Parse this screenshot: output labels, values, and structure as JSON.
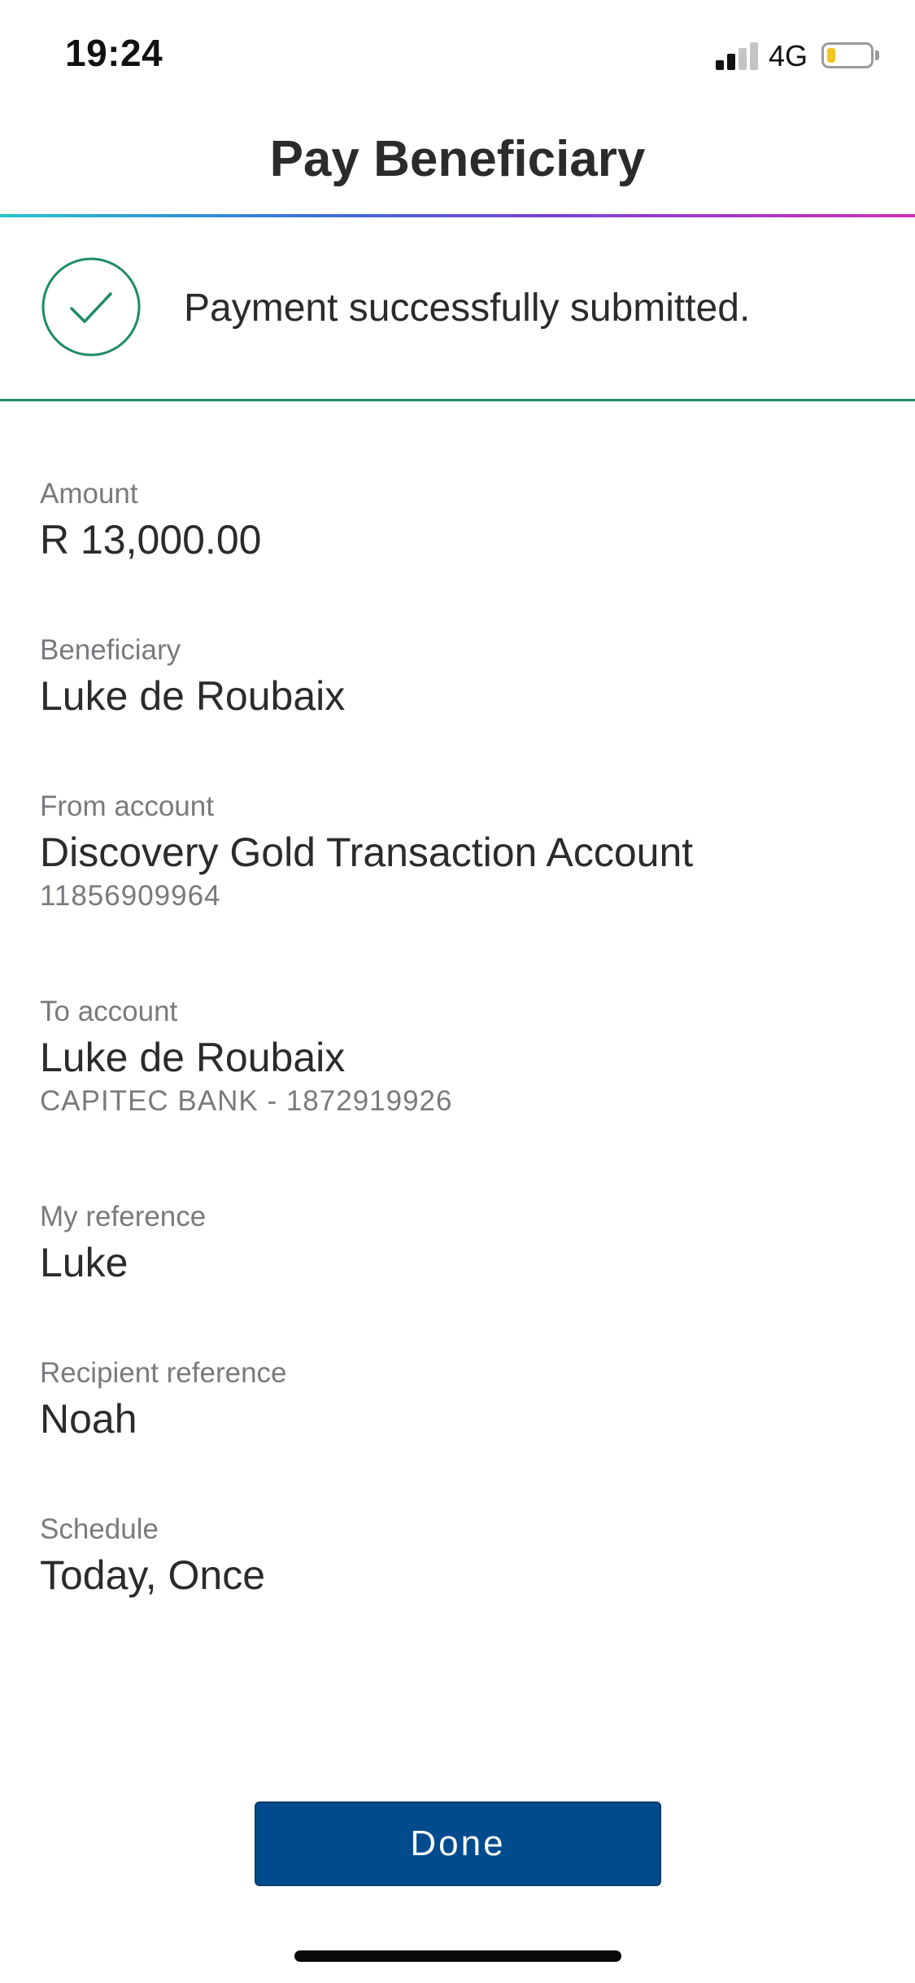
{
  "status_bar": {
    "time": "19:24",
    "network": "4G",
    "signal_icon": "cellular-signal-icon",
    "signal_bars_active": 2,
    "signal_bars_total": 4,
    "battery_icon": "battery-icon",
    "battery_level": 0.2,
    "battery_color": "#f3c623"
  },
  "header": {
    "title": "Pay Beneficiary"
  },
  "banner": {
    "icon": "checkmark-circle-icon",
    "message": "Payment successfully submitted.",
    "accent_color": "#1e8a68"
  },
  "details": {
    "amount": {
      "label": "Amount",
      "value": "R 13,000.00"
    },
    "beneficiary": {
      "label": "Beneficiary",
      "value": "Luke de Roubaix"
    },
    "from_account": {
      "label": "From account",
      "value": "Discovery Gold Transaction Account",
      "sub": "11856909964"
    },
    "to_account": {
      "label": "To account",
      "value": "Luke de Roubaix",
      "sub": "CAPITEC BANK - 1872919926"
    },
    "my_reference": {
      "label": "My reference",
      "value": "Luke"
    },
    "recipient_reference": {
      "label": "Recipient reference",
      "value": "Noah"
    },
    "schedule": {
      "label": "Schedule",
      "value": "Today, Once"
    }
  },
  "actions": {
    "done_label": "Done",
    "button_color": "#004b8d"
  }
}
